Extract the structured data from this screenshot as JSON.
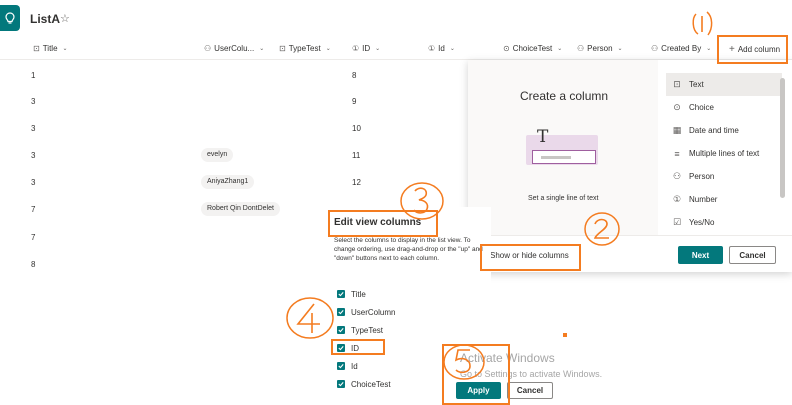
{
  "header": {
    "title": "ListA"
  },
  "columns": [
    {
      "label": "Title",
      "icon": "text-icon"
    },
    {
      "label": "UserColu...",
      "icon": "person-icon"
    },
    {
      "label": "TypeTest",
      "icon": "text-icon"
    },
    {
      "label": "ID",
      "icon": "number-icon"
    },
    {
      "label": "Id",
      "icon": "number-icon"
    },
    {
      "label": "ChoiceTest",
      "icon": "choice-icon"
    },
    {
      "label": "Person",
      "icon": "person-icon"
    },
    {
      "label": "Created By",
      "icon": ""
    }
  ],
  "add_column_label": "Add column",
  "rows": [
    {
      "title": "1",
      "user": "",
      "id": "8"
    },
    {
      "title": "3",
      "user": "",
      "id": "9"
    },
    {
      "title": "3",
      "user": "",
      "id": "10"
    },
    {
      "title": "3",
      "user": "evelyn",
      "id": "11"
    },
    {
      "title": "3",
      "user": "AniyaZhang1",
      "id": "12"
    },
    {
      "title": "7",
      "user": "Robert Qin DontDelet",
      "id": ""
    },
    {
      "title": "7",
      "user": "",
      "id": ""
    },
    {
      "title": "8",
      "user": "",
      "id": ""
    }
  ],
  "create_panel": {
    "title": "Create a column",
    "preview_caption": "Set a single line of text",
    "types": [
      {
        "label": "Text",
        "icon": "text-icon"
      },
      {
        "label": "Choice",
        "icon": "choice-icon"
      },
      {
        "label": "Date and time",
        "icon": "calendar-icon"
      },
      {
        "label": "Multiple lines of text",
        "icon": "multiline-icon"
      },
      {
        "label": "Person",
        "icon": "person-icon"
      },
      {
        "label": "Number",
        "icon": "number-icon"
      },
      {
        "label": "Yes/No",
        "icon": "yesno-icon"
      }
    ],
    "show_hide_label": "Show or hide columns",
    "next_label": "Next",
    "cancel_label": "Cancel"
  },
  "edit_panel": {
    "title": "Edit view columns",
    "description": "Select the columns to display in the list view. To change ordering, use drag-and-drop or the \"up\" and \"down\" buttons next to each column.",
    "columns": [
      "Title",
      "UserColumn",
      "TypeTest",
      "ID",
      "Id",
      "ChoiceTest"
    ],
    "apply_label": "Apply",
    "cancel_label": "Cancel"
  },
  "watermark": {
    "title": "Activate Windows",
    "subtitle": "Go to Settings to activate Windows."
  },
  "annotation_color": "#f47c20",
  "accent_color": "#03787c"
}
